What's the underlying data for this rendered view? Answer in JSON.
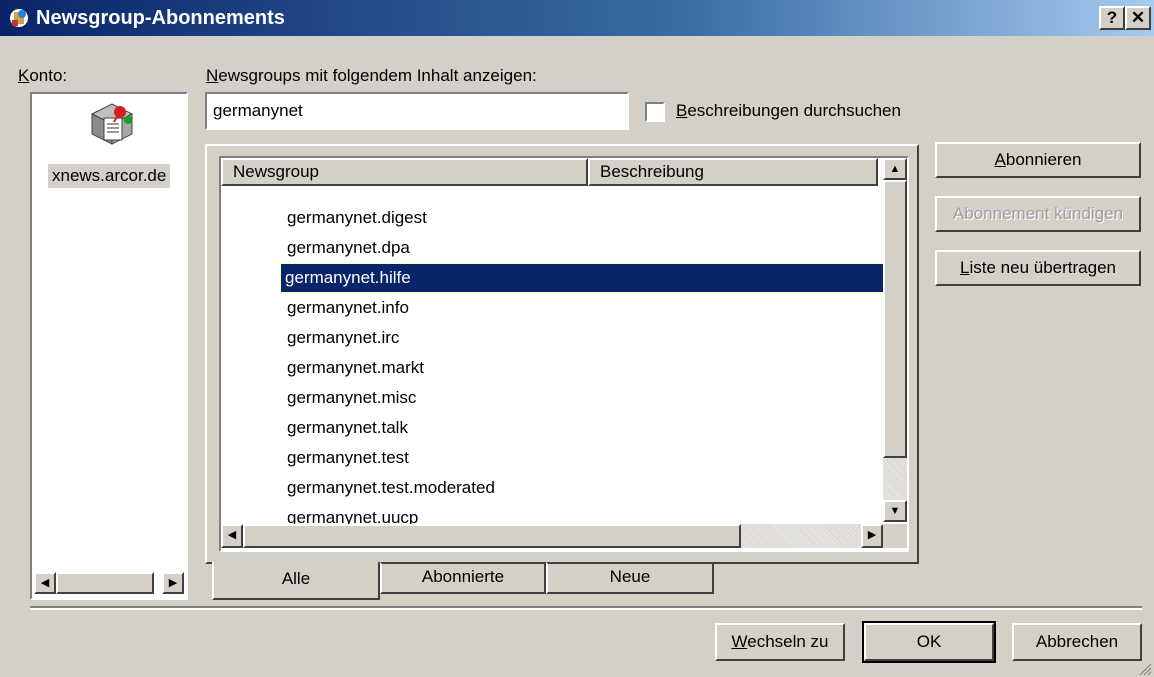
{
  "window": {
    "title": "Newsgroup-Abonnements",
    "help_btn": "?",
    "close_btn": "✕"
  },
  "konto": {
    "label": "Konto:",
    "accounts": [
      {
        "name": "xnews.arcor.de",
        "icon": "news-server-icon",
        "selected": true
      }
    ]
  },
  "filter": {
    "label": "Newsgroups mit folgendem Inhalt anzeigen:",
    "value": "germanynet",
    "search_descriptions_label": "Beschreibungen durchsuchen",
    "search_descriptions_checked": false
  },
  "list": {
    "columns": [
      "Newsgroup",
      "Beschreibung"
    ],
    "rows": [
      "germanynet.digest",
      "germanynet.dpa",
      "germanynet.hilfe",
      "germanynet.info",
      "germanynet.irc",
      "germanynet.markt",
      "germanynet.misc",
      "germanynet.talk",
      "germanynet.test",
      "germanynet.test.moderated",
      "germanynet.uucp"
    ],
    "selected": "germanynet.hilfe"
  },
  "actions": {
    "subscribe": "Abonnieren",
    "unsubscribe": "Abonnement kündigen",
    "refresh": "Liste neu übertragen"
  },
  "tabs": [
    "Alle",
    "Abonnierte",
    "Neue"
  ],
  "active_tab": "Alle",
  "footer": {
    "goto": "Wechseln zu",
    "ok": "OK",
    "cancel": "Abbrechen"
  },
  "colors": {
    "face": "#d4d0c8",
    "titlebar": "#0a246a",
    "selection": "#0a246a"
  }
}
